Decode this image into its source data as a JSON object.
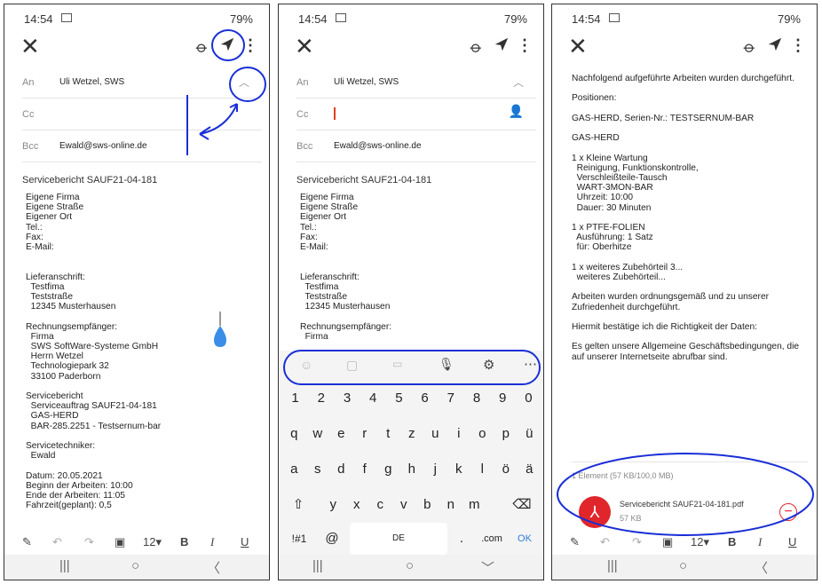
{
  "status": {
    "time": "14:54",
    "battery": "79%"
  },
  "p1": {
    "fields": [
      {
        "label": "An",
        "value": "Uli Wetzel, SWS"
      },
      {
        "label": "Cc",
        "value": ""
      },
      {
        "label": "Bcc",
        "value": "Ewald@sws-online.de"
      }
    ],
    "subject": "Servicebericht SAUF21-04-181",
    "body": "Eigene Firma\nEigene Straße\nEigener Ort\nTel.:\nFax:\nE-Mail:\n\n\nLieferanschrift:\n  Testfima\n  Teststraße\n  12345 Musterhausen\n\nRechnungsempfänger:\n  Firma\n  SWS SoftWare-Systeme GmbH\n  Herrn Wetzel\n  Technologiepark 32\n  33100 Paderborn\n\nServicebericht\n  Serviceauftrag SAUF21-04-181\n  GAS-HERD\n  BAR-285.2251 - Testsernum-bar\n\nServicetechniker:\n  Ewald\n\nDatum: 20.05.2021\nBeginn der Arbeiten: 10:00\nEnde der Arbeiten: 11:05\nFahrzeit(geplant): 0,5"
  },
  "p2": {
    "fields": [
      {
        "label": "An",
        "value": "Uli Wetzel, SWS"
      },
      {
        "label": "Cc",
        "value": ""
      },
      {
        "label": "Bcc",
        "value": "Ewald@sws-online.de"
      }
    ],
    "subject": "Servicebericht SAUF21-04-181",
    "body": "Eigene Firma\nEigene Straße\nEigener Ort\nTel.:\nFax:\nE-Mail:\n\n\nLieferanschrift:\n  Testfima\n  Teststraße\n  12345 Musterhausen\n\nRechnungsempfänger:\n  Firma",
    "keyboard": {
      "numbers": [
        "1",
        "2",
        "3",
        "4",
        "5",
        "6",
        "7",
        "8",
        "9",
        "0"
      ],
      "row1": [
        "q",
        "w",
        "e",
        "r",
        "t",
        "z",
        "u",
        "i",
        "o",
        "p",
        "ü"
      ],
      "row2": [
        "a",
        "s",
        "d",
        "f",
        "g",
        "h",
        "j",
        "k",
        "l",
        "ö",
        "ä"
      ],
      "row3": [
        "y",
        "x",
        "c",
        "v",
        "b",
        "n",
        "m"
      ],
      "sym": "!#1",
      "at": "@",
      "space": "DE",
      "dot": ".",
      "com": ".com",
      "ok": "OK"
    }
  },
  "p3": {
    "body": "Nachfolgend aufgeführte Arbeiten wurden durchgeführt.\n\nPositionen:\n\nGAS-HERD, Serien-Nr.: TESTSERNUM-BAR\n\nGAS-HERD\n\n1 x Kleine Wartung\n  Reinigung, Funktionskontrolle,\n  Verschleißteile-Tausch\n  WART-3MON-BAR\n  Uhrzeit: 10:00\n  Dauer: 30 Minuten\n\n1 x PTFE-FOLIEN\n  Ausführung: 1 Satz\n  für: Oberhitze\n\n1 x weiteres Zubehörteil 3...\n  weiteres Zubehörteil...\n\nArbeiten wurden ordnungsgemäß und zu unserer\nZufriedenheit durchgeführt.\n\nHiermit bestätige ich die Richtigkeit der Daten:\n\nEs gelten unsere Allgemeine Geschäftsbedingungen, die\nauf unserer Internetseite abrufbar sind.",
    "attach_summary": "1 Element  (57 KB/100,0 MB)",
    "attach_name": "Servicebericht SAUF21-04-181.pdf",
    "attach_size": "57 KB"
  },
  "fmt": {
    "size": "12",
    "bold": "B",
    "italic": "I",
    "underline": "U"
  },
  "colors": {
    "annotation": "#1a2fd6",
    "pdf_red": "#e0262b",
    "accent_ok": "#2e7bd6"
  }
}
